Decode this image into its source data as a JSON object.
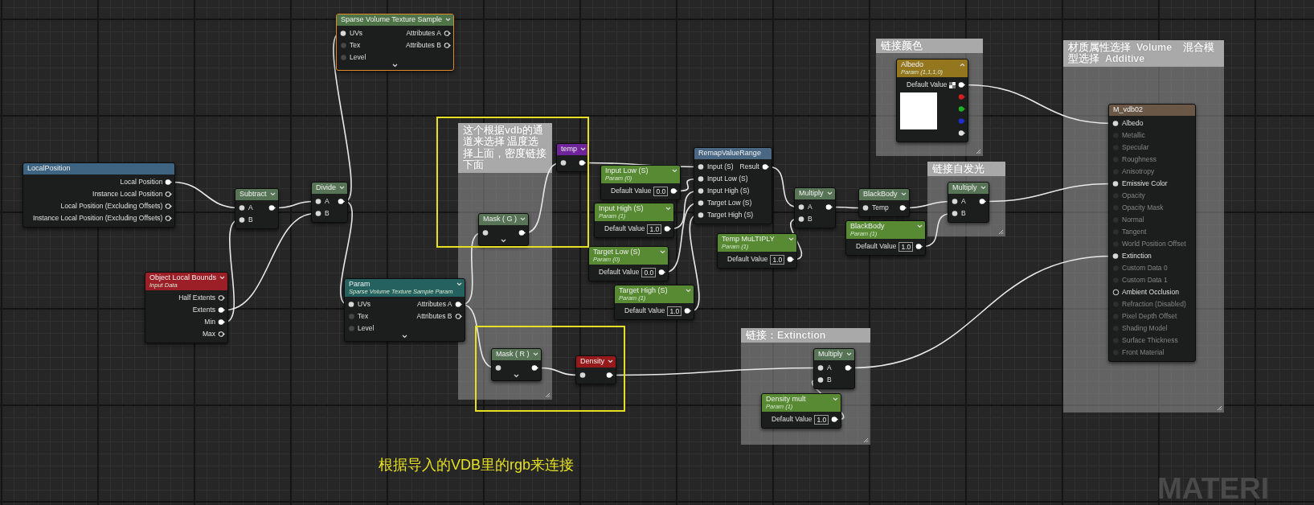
{
  "nodes": [
    {
      "title": "Sparse Volume Texture Sample",
      "color": "#4e7448",
      "selected": true,
      "collapsible": true,
      "chevron_up": false,
      "expander": true,
      "rows": [
        {
          "input": {
            "label": "UVs",
            "connected": true
          },
          "output": {
            "label": "Attributes A",
            "connected": false
          }
        },
        {
          "input": {
            "label": "Tex",
            "connected": false
          },
          "output": {
            "label": "Attributes B",
            "connected": false
          }
        },
        {
          "input": {
            "label": "Level",
            "connected": false
          }
        }
      ]
    },
    {
      "title": "LocalPosition",
      "color": "#3e6482",
      "selected": false,
      "collapsible": false,
      "rows": [
        {
          "output": {
            "label": "Local Position",
            "connected": true
          }
        },
        {
          "output": {
            "label": "Instance Local Position",
            "connected": false
          }
        },
        {
          "output": {
            "label": "Local Position (Excluding Offsets)",
            "connected": false
          }
        },
        {
          "output": {
            "label": "Instance Local Position (Excluding Offsets)",
            "connected": false
          }
        }
      ]
    },
    {
      "title": "Subtract",
      "color": "#587456",
      "selected": false,
      "collapsible": true,
      "chevron_up": false,
      "rows": [
        {
          "input": {
            "label": "A",
            "connected": true
          },
          "output": {
            "connected": true
          }
        },
        {
          "input": {
            "label": "B",
            "connected": true
          }
        }
      ]
    },
    {
      "title": "Divide",
      "color": "#587456",
      "selected": false,
      "collapsible": true,
      "chevron_up": false,
      "rows": [
        {
          "input": {
            "label": "A",
            "connected": true
          },
          "output": {
            "connected": true
          }
        },
        {
          "input": {
            "label": "B",
            "connected": true
          }
        }
      ]
    },
    {
      "title": "Object Local Bounds",
      "subtitle": "Input Data",
      "color": "#9c1e26",
      "selected": false,
      "collapsible": true,
      "chevron_up": false,
      "rows": [
        {
          "output": {
            "label": "Half Extents",
            "connected": false
          }
        },
        {
          "output": {
            "label": "Extents",
            "connected": true
          }
        },
        {
          "output": {
            "label": "Min",
            "connected": true
          }
        },
        {
          "output": {
            "label": "Max",
            "connected": false
          }
        }
      ]
    },
    {
      "title": "Param",
      "subtitle": "Sparse Volume Texture Sample Param",
      "color": "#25625f",
      "selected": false,
      "collapsible": true,
      "chevron_up": false,
      "expander": true,
      "rows": [
        {
          "input": {
            "label": "UVs",
            "connected": true
          },
          "output": {
            "label": "Attributes A",
            "connected": true
          }
        },
        {
          "input": {
            "label": "Tex",
            "connected": false
          },
          "output": {
            "label": "Attributes B",
            "connected": false
          }
        },
        {
          "input": {
            "label": "Level",
            "connected": false
          }
        }
      ]
    },
    {
      "title": "Mask ( G )",
      "color": "#587456",
      "selected": false,
      "collapsible": true,
      "chevron_up": false,
      "expander": true,
      "rows": [
        {
          "input": {
            "connected": true
          },
          "output": {
            "connected": true
          }
        }
      ]
    },
    {
      "title": "temp",
      "color": "#70249a",
      "selected": false,
      "collapsible": true,
      "chevron_up": false,
      "rows": [
        {
          "input": {
            "connected": true
          },
          "output": {
            "connected": true
          }
        }
      ]
    },
    {
      "title": "Mask ( R )",
      "color": "#587456",
      "selected": false,
      "collapsible": true,
      "chevron_up": false,
      "expander": true,
      "rows": [
        {
          "input": {
            "connected": true
          },
          "output": {
            "connected": true
          }
        }
      ]
    },
    {
      "title": "Density",
      "color": "#961a1c",
      "selected": false,
      "collapsible": true,
      "chevron_up": false,
      "rows": [
        {
          "input": {
            "connected": true
          },
          "output": {
            "connected": true
          }
        }
      ]
    },
    {
      "title": "Input Low (S)",
      "subtitle": "Param (0)",
      "color": "#578a32",
      "selected": false,
      "collapsible": true,
      "chevron_up": false,
      "rows": [
        {
          "output": {
            "label": "Default Value",
            "value": "0.0",
            "connected": true
          }
        }
      ]
    },
    {
      "title": "Input High (S)",
      "subtitle": "Param (1)",
      "color": "#578a32",
      "selected": false,
      "collapsible": true,
      "chevron_up": false,
      "rows": [
        {
          "output": {
            "label": "Default Value",
            "value": "1.0",
            "connected": true
          }
        }
      ]
    },
    {
      "title": "Target Low (S)",
      "subtitle": "Param (0)",
      "color": "#578a32",
      "selected": false,
      "collapsible": true,
      "chevron_up": false,
      "rows": [
        {
          "output": {
            "label": "Default Value",
            "value": "0.0",
            "connected": true
          }
        }
      ]
    },
    {
      "title": "Target High (S)",
      "subtitle": "Param (1)",
      "color": "#578a32",
      "selected": false,
      "collapsible": true,
      "chevron_up": false,
      "rows": [
        {
          "output": {
            "label": "Default Value",
            "value": "1.0",
            "connected": true
          }
        }
      ]
    },
    {
      "title": "RemapValueRange",
      "color": "#4a6784",
      "selected": false,
      "collapsible": false,
      "rows": [
        {
          "input": {
            "label": "Input (S)",
            "connected": true
          },
          "output": {
            "label": "Result",
            "connected": true
          }
        },
        {
          "input": {
            "label": "Input Low (S)",
            "connected": true
          }
        },
        {
          "input": {
            "label": "Input High (S)",
            "connected": true
          }
        },
        {
          "input": {
            "label": "Target Low (S)",
            "connected": true
          }
        },
        {
          "input": {
            "label": "Target High (S)",
            "connected": true
          }
        }
      ]
    },
    {
      "title": "Temp MuLTIPLY",
      "subtitle": "Param (1)",
      "color": "#578a32",
      "selected": false,
      "collapsible": true,
      "chevron_up": false,
      "rows": [
        {
          "output": {
            "label": "Default Value",
            "value": "1.0",
            "connected": true
          }
        }
      ]
    },
    {
      "title": "Multiply",
      "color": "#587456",
      "selected": false,
      "collapsible": true,
      "chevron_up": false,
      "rows": [
        {
          "input": {
            "label": "A",
            "connected": true
          },
          "output": {
            "connected": true
          }
        },
        {
          "input": {
            "label": "B",
            "connected": true
          }
        }
      ]
    },
    {
      "title": "BlackBody",
      "color": "#587456",
      "selected": false,
      "collapsible": true,
      "chevron_up": false,
      "rows": [
        {
          "input": {
            "label": "Temp",
            "connected": true
          },
          "output": {
            "connected": true
          }
        }
      ]
    },
    {
      "title": "BlackBody",
      "subtitle": "Param (1)",
      "color": "#578a32",
      "selected": false,
      "collapsible": true,
      "chevron_up": false,
      "rows": [
        {
          "output": {
            "label": "Default Value",
            "value": "1.0",
            "connected": true
          }
        }
      ]
    },
    {
      "title": "Albedo",
      "subtitle": "Param (1,1,1,0)",
      "color": "#94761e",
      "selected": false,
      "collapsible": true,
      "chevron_up": true,
      "preview": {
        "color": "#ffffff"
      },
      "rows": [
        {
          "output": {
            "label": "Default Value",
            "checker": true,
            "connected": true
          }
        },
        {
          "output": {
            "color": "#d02020",
            "connected": false
          }
        },
        {
          "output": {
            "color": "#20b020",
            "connected": false
          }
        },
        {
          "output": {
            "color": "#2030d0",
            "connected": false
          }
        },
        {
          "output": {
            "color": "#e0e0e0",
            "connected": false
          }
        }
      ]
    },
    {
      "title": "Multiply",
      "color": "#587456",
      "selected": false,
      "collapsible": true,
      "chevron_up": false,
      "rows": [
        {
          "input": {
            "label": "A",
            "connected": true
          },
          "output": {
            "connected": true
          }
        },
        {
          "input": {
            "label": "B",
            "connected": true
          }
        }
      ]
    },
    {
      "title": "Multiply",
      "color": "#587456",
      "selected": false,
      "collapsible": true,
      "chevron_up": false,
      "rows": [
        {
          "input": {
            "label": "A",
            "connected": true
          },
          "output": {
            "connected": true
          }
        },
        {
          "input": {
            "label": "B",
            "connected": true
          }
        }
      ]
    },
    {
      "title": "Density mult",
      "subtitle": "Param (1)",
      "color": "#578a32",
      "selected": false,
      "collapsible": true,
      "chevron_up": false,
      "rows": [
        {
          "output": {
            "label": "Default Value",
            "value": "1.0",
            "connected": true
          }
        }
      ]
    },
    {
      "title": "M_vdb02",
      "color": "#6a5746",
      "selected": false,
      "collapsible": false,
      "rows": [
        {
          "input": {
            "label": "Albedo",
            "connected": true,
            "disabled": false
          }
        },
        {
          "input": {
            "label": "Metallic",
            "connected": false,
            "disabled": true
          }
        },
        {
          "input": {
            "label": "Specular",
            "connected": false,
            "disabled": true
          }
        },
        {
          "input": {
            "label": "Roughness",
            "connected": false,
            "disabled": true
          }
        },
        {
          "input": {
            "label": "Anisotropy",
            "connected": false,
            "disabled": true
          }
        },
        {
          "input": {
            "label": "Emissive Color",
            "connected": true,
            "disabled": false
          }
        },
        {
          "input": {
            "label": "Opacity",
            "connected": false,
            "disabled": true
          }
        },
        {
          "input": {
            "label": "Opacity Mask",
            "connected": false,
            "disabled": true
          }
        },
        {
          "input": {
            "label": "Normal",
            "connected": false,
            "disabled": true
          }
        },
        {
          "input": {
            "label": "Tangent",
            "connected": false,
            "disabled": true
          }
        },
        {
          "input": {
            "label": "World Position Offset",
            "connected": false,
            "disabled": true
          }
        },
        {
          "input": {
            "label": "Extinction",
            "connected": true,
            "disabled": false
          }
        },
        {
          "input": {
            "label": "Custom Data 0",
            "connected": false,
            "disabled": true
          }
        },
        {
          "input": {
            "label": "Custom Data 1",
            "connected": false,
            "disabled": true
          }
        },
        {
          "input": {
            "label": "Ambient Occlusion",
            "connected": false,
            "disabled": false
          }
        },
        {
          "input": {
            "label": "Refraction (Disabled)",
            "connected": false,
            "disabled": true
          }
        },
        {
          "input": {
            "label": "Pixel Depth Offset",
            "connected": false,
            "disabled": true
          }
        },
        {
          "input": {
            "label": "Shading Model",
            "connected": false,
            "disabled": true
          }
        },
        {
          "input": {
            "label": "Surface Thickness",
            "connected": false,
            "disabled": true
          }
        },
        {
          "input": {
            "label": "Front Material",
            "connected": false,
            "disabled": true
          }
        }
      ]
    }
  ],
  "comments": [
    {
      "title": "这个根据vdb的通道来选择 温度选择上面，密度链接下面"
    },
    {
      "title": "链接颜色"
    },
    {
      "title": "链接自发光"
    },
    {
      "title": "链接：Extinction"
    },
    {
      "title": "材质属性选择  Volume    混合模型选择  Additive"
    }
  ],
  "note": "根据导入的VDB里的rgb来连接",
  "background_label": "MATERI"
}
